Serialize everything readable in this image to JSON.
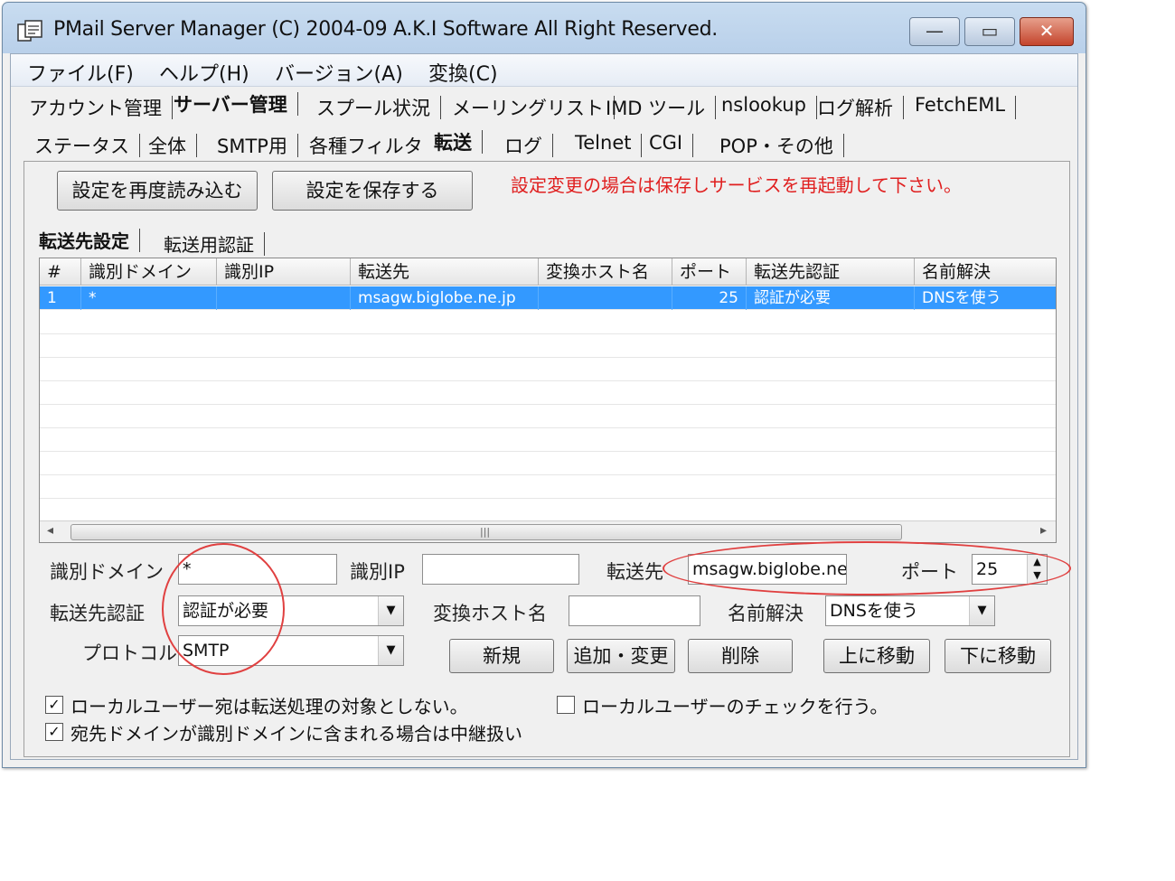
{
  "window": {
    "title": "PMail Server Manager (C) 2004-09 A.K.I Software All Right Reserved.",
    "minimize": "—",
    "maximize": "▭",
    "close": "✕"
  },
  "menu": [
    "ファイル(F)",
    "ヘルプ(H)",
    "バージョン(A)",
    "変換(C)"
  ],
  "main_tabs": [
    "アカウント管理",
    "サーバー管理",
    "スプール状況",
    "メーリングリスト",
    "IMD ツール",
    "nslookup",
    "ログ解析",
    "FetchEML"
  ],
  "sub_tabs": [
    "ステータス",
    "全体",
    "SMTP用",
    "各種フィルタ",
    "転送",
    "ログ",
    "Telnet",
    "CGI",
    "POP・その他"
  ],
  "buttons": {
    "reload": "設定を再度読み込む",
    "save": "設定を保存する"
  },
  "notice": "設定変更の場合は保存しサービスを再起動して下さい。",
  "inner_tabs": [
    "転送先設定",
    "転送用認証"
  ],
  "grid": {
    "columns": [
      "#",
      "識別ドメイン",
      "識別IP",
      "転送先",
      "変換ホスト名",
      "ポート",
      "転送先認証",
      "名前解決"
    ],
    "rows": [
      [
        "1",
        "*",
        "",
        "msagw.biglobe.ne.jp",
        "",
        "25",
        "認証が必要",
        "DNSを使う"
      ]
    ]
  },
  "form": {
    "domain_label": "識別ドメイン",
    "domain_value": "*",
    "ip_label": "識別IP",
    "ip_value": "",
    "dest_label": "転送先",
    "dest_value": "msagw.biglobe.ne.j",
    "port_label": "ポート",
    "port_value": "25",
    "auth_label": "転送先認証",
    "auth_value": "認証が必要",
    "host_label": "変換ホスト名",
    "host_value": "",
    "resolve_label": "名前解決",
    "resolve_value": "DNSを使う",
    "proto_label": "プロトコル",
    "proto_value": "SMTP"
  },
  "actions": [
    "新規",
    "追加・変更",
    "削除",
    "上に移動",
    "下に移動"
  ],
  "checks": [
    {
      "label": "ローカルユーザー宛は転送処理の対象としない。",
      "checked": true
    },
    {
      "label": "ローカルユーザーのチェックを行う。",
      "checked": false
    },
    {
      "label": "宛先ドメインが識別ドメインに含まれる場合は中継扱い",
      "checked": true
    }
  ],
  "highlight_color": "#e04040",
  "selection_color": "#3399ff"
}
